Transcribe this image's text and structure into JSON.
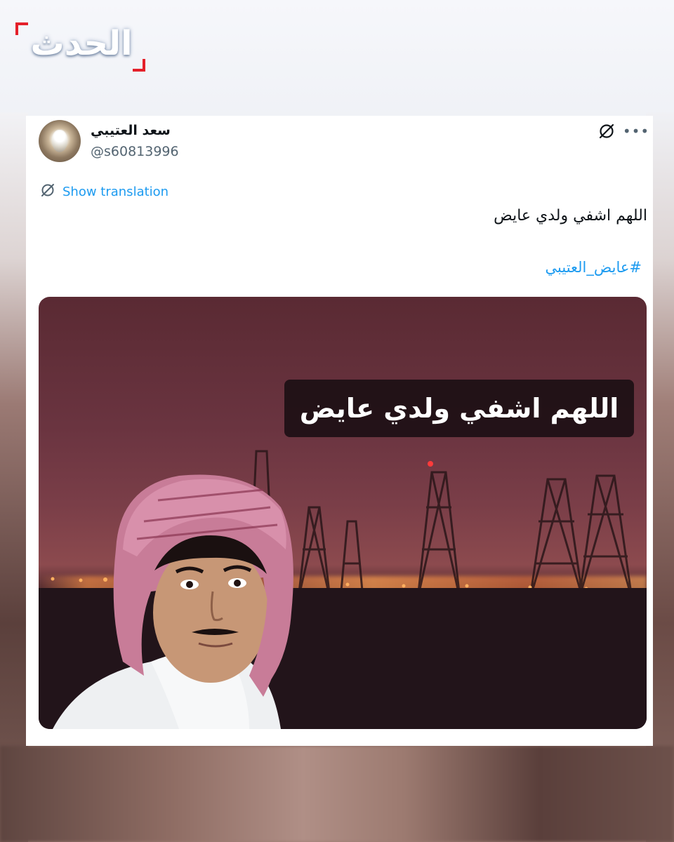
{
  "brand": {
    "logo_text": "الحدث"
  },
  "tweet": {
    "display_name": "سعد العتيبي",
    "handle": "@s60813996",
    "translate_label": "Show translation",
    "text": "اللهم اشفي ولدي عايض",
    "hashtag": "#عايض_العتيبي",
    "media": {
      "caption": "اللهم اشفي ولدي عايض"
    }
  },
  "icons": {
    "grok": "grok-icon",
    "more": "more-options-icon",
    "translate": "translate-icon"
  },
  "colors": {
    "link": "#1d9bf0",
    "text": "#0f1419",
    "secondary": "#536471",
    "logo_accent": "#e4202a"
  }
}
